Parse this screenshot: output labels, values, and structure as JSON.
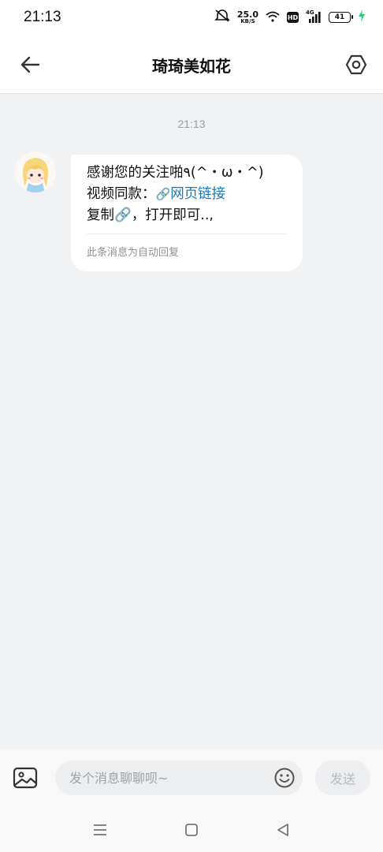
{
  "status_bar": {
    "time": "21:13",
    "net_speed_value": "25.0",
    "net_speed_unit": "KB/S",
    "hd_label": "HD",
    "network_label": "4G",
    "battery_level": "41",
    "icons": [
      "mute-icon",
      "wifi-icon",
      "signal-icon",
      "battery-icon",
      "charging-icon"
    ]
  },
  "header": {
    "title": "琦琦美如花",
    "back_icon": "arrow-left-icon",
    "settings_icon": "hexagon-settings-icon"
  },
  "chat": {
    "timestamp": "21:13",
    "messages": [
      {
        "sender": "琦琦美如花",
        "line1": "感谢您的关注啪٩(^・ω・^)",
        "line2_prefix": "视频同款：",
        "link_icon": "🔗",
        "link_text": "网页链接",
        "line3": "复制🔗，打开即可..,",
        "auto_reply_note": "此条消息为自动回复"
      }
    ]
  },
  "input_bar": {
    "placeholder": "发个消息聊聊呗~",
    "send_label": "发送",
    "image_icon": "image-icon",
    "emoji_icon": "emoji-icon"
  },
  "nav_bar": {
    "icons": [
      "menu-icon",
      "home-square-icon",
      "back-triangle-icon"
    ]
  },
  "colors": {
    "link": "#1b78b8",
    "background": "#f1f2f4",
    "bubble": "#ffffff",
    "charging": "#2ecc71"
  }
}
